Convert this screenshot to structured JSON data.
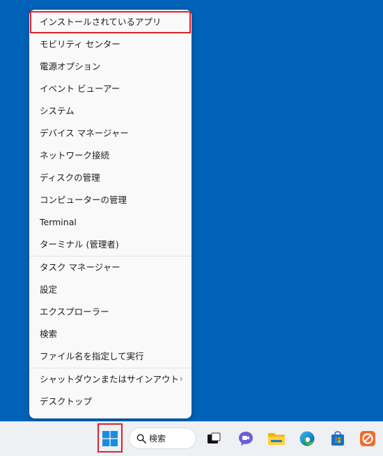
{
  "menu": {
    "items": [
      {
        "label": "インストールされているアプリ"
      },
      {
        "label": "モビリティ センター"
      },
      {
        "label": "電源オプション"
      },
      {
        "label": "イベント ビューアー"
      },
      {
        "label": "システム"
      },
      {
        "label": "デバイス マネージャー"
      },
      {
        "label": "ネットワーク接続"
      },
      {
        "label": "ディスクの管理"
      },
      {
        "label": "コンピューターの管理"
      },
      {
        "label": "Terminal"
      },
      {
        "label": "ターミナル (管理者)"
      },
      {
        "label": "タスク マネージャー"
      },
      {
        "label": "設定"
      },
      {
        "label": "エクスプローラー"
      },
      {
        "label": "検索"
      },
      {
        "label": "ファイル名を指定して実行"
      },
      {
        "label": "シャットダウンまたはサインアウト"
      },
      {
        "label": "デスクトップ"
      }
    ],
    "submenu_chevron": "›"
  },
  "taskbar": {
    "search_label": "検索"
  },
  "colors": {
    "desktop": "#0062b8",
    "highlight": "#e0202c",
    "menu_bg": "#f9f9f9",
    "taskbar_bg": "#eef0f4"
  },
  "icons": [
    "windows-start-icon",
    "search-icon",
    "task-view-icon",
    "meet-chat-icon",
    "file-explorer-icon",
    "edge-icon",
    "store-icon",
    "app-icon"
  ]
}
